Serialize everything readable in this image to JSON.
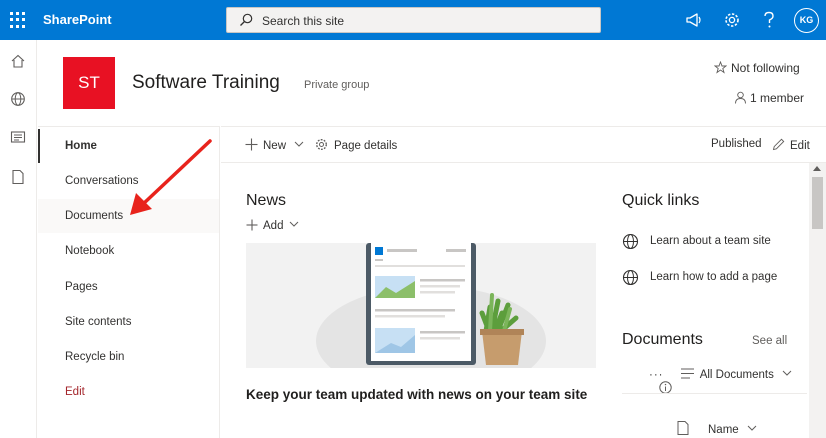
{
  "suite": {
    "brand": "SharePoint",
    "search_placeholder": "Search this site",
    "avatar_initials": "KG",
    "accent": "#0078d4"
  },
  "site": {
    "logo_text": "ST",
    "logo_color": "#e81123",
    "title": "Software Training",
    "privacy": "Private group",
    "follow_label": "Not following",
    "members_label": "1 member"
  },
  "nav": {
    "items": [
      {
        "label": "Home"
      },
      {
        "label": "Conversations"
      },
      {
        "label": "Documents"
      },
      {
        "label": "Notebook"
      },
      {
        "label": "Pages"
      },
      {
        "label": "Site contents"
      },
      {
        "label": "Recycle bin"
      },
      {
        "label": "Edit"
      }
    ]
  },
  "commandbar": {
    "new_label": "New",
    "page_details_label": "Page details",
    "status": "Published",
    "edit_label": "Edit"
  },
  "news": {
    "heading": "News",
    "add_label": "Add",
    "card_title": "Keep your team updated with news on your team site"
  },
  "quicklinks": {
    "heading": "Quick links",
    "items": [
      {
        "label": "Learn about a team site"
      },
      {
        "label": "Learn how to add a page"
      }
    ]
  },
  "documents": {
    "heading": "Documents",
    "see_all": "See all",
    "more": "···",
    "view_label": "All Documents",
    "name_column": "Name"
  },
  "icons": [
    "waffle-icon",
    "search-icon",
    "megaphone-icon",
    "gear-icon",
    "help-icon",
    "home-icon",
    "globe-icon",
    "news-icon",
    "document-icon",
    "star-icon",
    "person-icon",
    "plus-icon",
    "settings-icon",
    "pencil-icon",
    "chevron-down-icon",
    "list-icon",
    "info-icon",
    "arrow-annotation"
  ]
}
